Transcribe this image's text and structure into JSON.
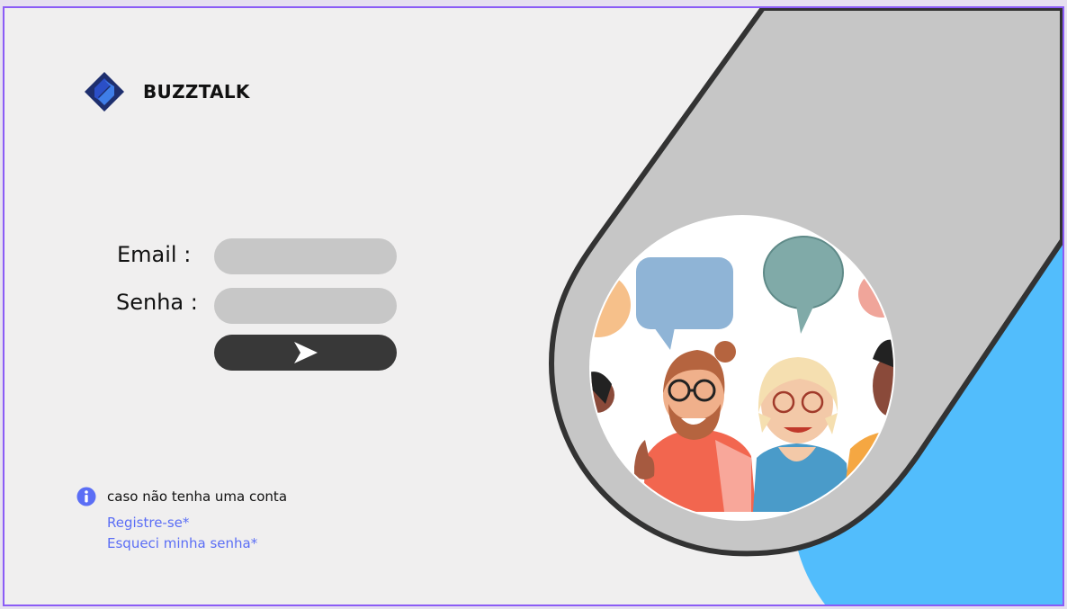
{
  "brand": {
    "name": "BUZZTALK",
    "icon": "diamond-logo"
  },
  "login": {
    "email_label": "Email  :",
    "password_label": "Senha :",
    "email_value": "",
    "password_value": "",
    "submit_icon": "send-icon"
  },
  "help": {
    "info_icon": "info-icon",
    "text": "caso não tenha uma conta",
    "register_link": "Registre-se*",
    "forgot_link": "Esqueci minha senha*"
  },
  "colors": {
    "background": "#f0efef",
    "frame_border": "#8b5cf6",
    "input_bg": "#c7c7c7",
    "button_bg": "#383838",
    "link": "#5b6ef5",
    "accent_blue": "#52bdfc",
    "band_gray": "#c6c6c6"
  },
  "illustration": {
    "subject": "group-chat-people-illustration"
  }
}
